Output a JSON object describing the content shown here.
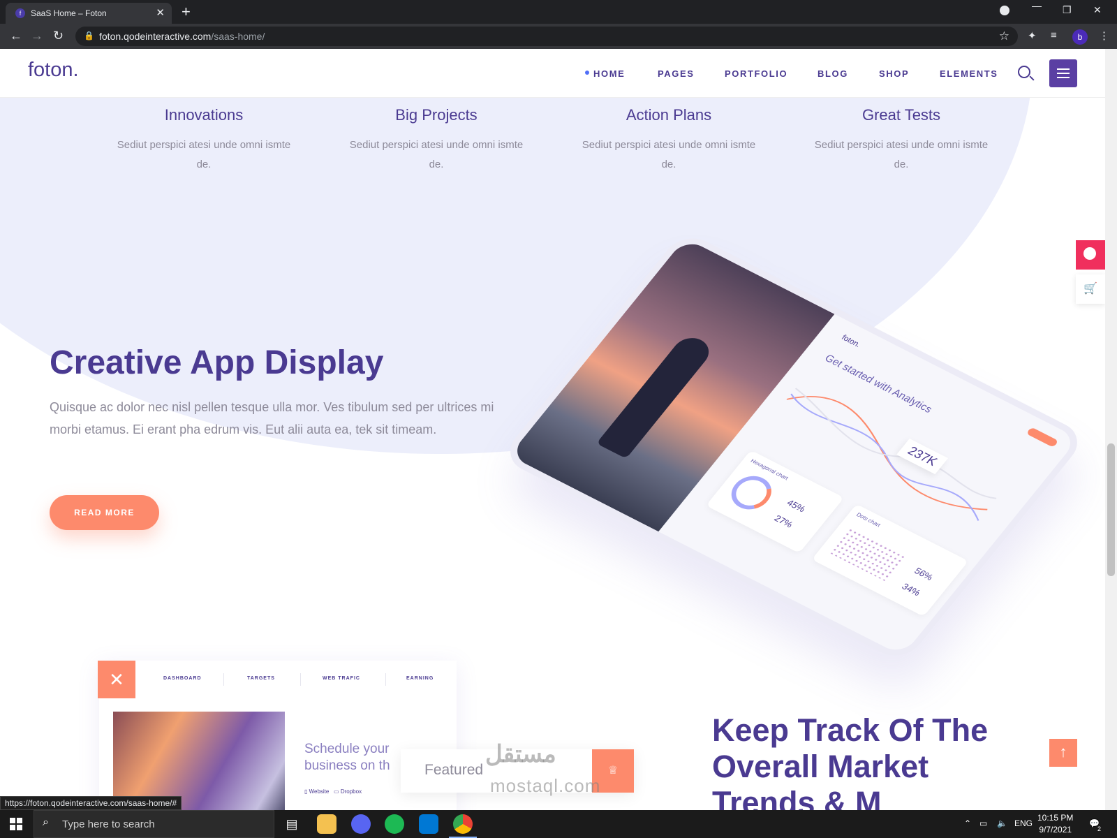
{
  "browser": {
    "tab_title": "SaaS Home – Foton",
    "tab_favicon": "f",
    "tab_close": "✕",
    "new_tab": "+",
    "url_host": "foton.qodeinteractive.com",
    "url_path": "/saas-home/",
    "profile_initial": "b",
    "status_url": "https://foton.qodeinteractive.com/saas-home/#"
  },
  "site": {
    "logo": "foton.",
    "nav": [
      "HOME",
      "PAGES",
      "PORTFOLIO",
      "BLOG",
      "SHOP",
      "ELEMENTS"
    ],
    "active_nav": "HOME"
  },
  "features": [
    {
      "title": "Innovations",
      "text": "Sediut perspici atesi unde omni ismte de."
    },
    {
      "title": "Big Projects",
      "text": "Sediut perspici atesi unde omni ismte de."
    },
    {
      "title": "Action Plans",
      "text": "Sediut perspici atesi unde omni ismte de."
    },
    {
      "title": "Great Tests",
      "text": "Sediut perspici atesi unde omni ismte de."
    }
  ],
  "hero": {
    "title": "Creative App Display",
    "text": "Quisque ac dolor nec nisl pellen tesque ulla mor. Ves tibulum sed per ultrices mi morbi etamus. Ei erant pha edrum vis. Eut alii auta ea, tek sit timeam.",
    "button": "READ MORE"
  },
  "tablet": {
    "logo": "foton.",
    "heading": "Get started with Analytics",
    "stat": "237K",
    "card1_caption": "Hexagonal chart",
    "card1_v1": "45%",
    "card1_v2": "27%",
    "card2_caption": "Dots chart",
    "card2_v1": "56%",
    "card2_v2": "34%"
  },
  "dashboard": {
    "close": "✕",
    "tabs": [
      "DASHBOARD",
      "TARGETS",
      "WEB TRAFIC",
      "EARNING"
    ],
    "schedule": "Schedule your business on th",
    "link1": "Website",
    "link2": "Dropbox"
  },
  "featured": {
    "label": "Featured",
    "icon": "♕"
  },
  "track": {
    "title": "Keep Track Of The Overall Market Trends & M"
  },
  "watermark": {
    "arabic": "مستقل",
    "latin": "mostaql.com"
  },
  "taskbar": {
    "search_placeholder": "Type here to search",
    "lang": "ENG",
    "time": "10:15 PM",
    "date": "9/7/2021",
    "notif_count": "2"
  },
  "colors": {
    "brand": "#4a3a91",
    "accent": "#fd8a6c",
    "pink": "#f02f5d",
    "blob": "#eceefb"
  }
}
